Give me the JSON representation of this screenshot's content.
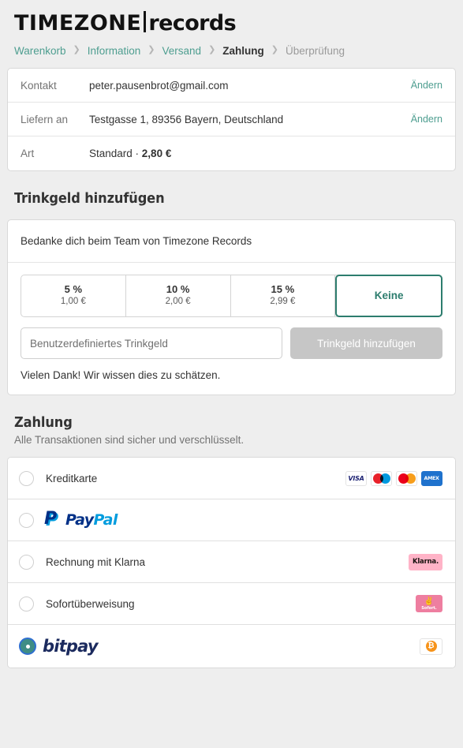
{
  "brand": {
    "logo_part1": "TIMEZONE",
    "logo_divider": "|",
    "logo_part2": "records"
  },
  "breadcrumb": {
    "items": [
      {
        "label": "Warenkorb",
        "state": "link"
      },
      {
        "label": "Information",
        "state": "link"
      },
      {
        "label": "Versand",
        "state": "link"
      },
      {
        "label": "Zahlung",
        "state": "current"
      },
      {
        "label": "Überprüfung",
        "state": "upcoming"
      }
    ],
    "separator": "❯"
  },
  "review": {
    "rows": [
      {
        "label": "Kontakt",
        "value": "peter.pausenbrot@gmail.com",
        "action": "Ändern"
      },
      {
        "label": "Liefern an",
        "value": "Testgasse 1, 89356 Bayern, Deutschland",
        "action": "Ändern"
      }
    ],
    "method_row": {
      "label": "Art",
      "value_prefix": "Standard · ",
      "value_price": "2,80 €"
    }
  },
  "tip": {
    "heading": "Trinkgeld hinzufügen",
    "message": "Bedanke dich beim Team von Timezone Records",
    "options": [
      {
        "percent": "5 %",
        "amount": "1,00 €",
        "selected": false
      },
      {
        "percent": "10 %",
        "amount": "2,00 €",
        "selected": false
      },
      {
        "percent": "15 %",
        "amount": "2,99 €",
        "selected": false
      }
    ],
    "none_label": "Keine",
    "none_selected": true,
    "custom_placeholder": "Benutzerdefiniertes Trinkgeld",
    "custom_value": "",
    "add_button_label": "Trinkgeld hinzufügen",
    "add_button_disabled": true,
    "thanks_text": "Vielen Dank! Wir wissen dies zu schätzen."
  },
  "payment": {
    "heading": "Zahlung",
    "subtitle": "Alle Transaktionen sind sicher und verschlüsselt.",
    "methods": [
      {
        "id": "credit-card",
        "label": "Kreditkarte",
        "selected": false,
        "brands": [
          "visa",
          "maestro",
          "mastercard",
          "amex"
        ],
        "brand_labels": {
          "visa": "VISA",
          "amex": "AMEX"
        }
      },
      {
        "id": "paypal",
        "label": "PayPal",
        "logo_text_1": "Pay",
        "logo_text_2": "Pal",
        "selected": false
      },
      {
        "id": "klarna",
        "label": "Rechnung mit Klarna",
        "badge_text": "Klarna.",
        "selected": false
      },
      {
        "id": "sofort",
        "label": "Sofortüberweisung",
        "badge_text": "Sofort.",
        "selected": false
      },
      {
        "id": "bitpay",
        "label": "bitpay",
        "badge_text": "₿",
        "selected": true
      }
    ]
  },
  "colors": {
    "accent_teal": "#4e9e90",
    "accent_teal_dark": "#2d7d6e",
    "page_bg": "#eeeeee",
    "card_bg": "#ffffff",
    "border": "#d9d9d9",
    "text": "#333333",
    "muted": "#737373",
    "visa_blue": "#1a1f71",
    "amex_blue": "#1f72cd",
    "klarna_pink": "#ffb3c7",
    "sofort_pink": "#ee7ea0",
    "bitcoin_orange": "#f7931a",
    "bitpay_navy": "#1b2a5e",
    "paypal_dark": "#003087",
    "paypal_light": "#009cde"
  }
}
